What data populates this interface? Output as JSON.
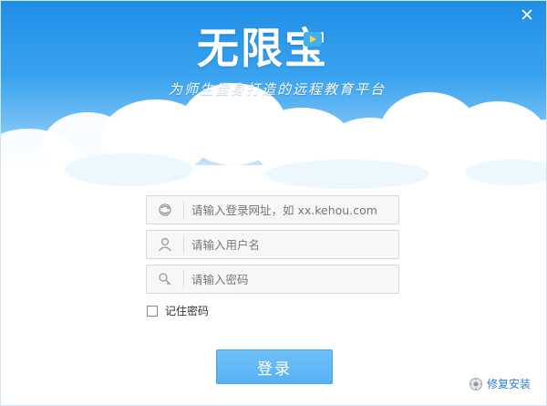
{
  "app": {
    "logo_text": "无限宝",
    "slogan": "为师生量身打造的远程教育平台"
  },
  "form": {
    "url": {
      "placeholder": "请输入登录网址，如 xx.kehou.com",
      "value": "",
      "icon": "refresh-globe-icon"
    },
    "username": {
      "placeholder": "请输入用户名",
      "value": "",
      "icon": "user-icon"
    },
    "password": {
      "placeholder": "请输入密码",
      "value": "",
      "icon": "key-icon"
    },
    "remember_label": "记住密码",
    "remember_checked": false,
    "login_label": "登录"
  },
  "footer": {
    "repair_label": "修复安装",
    "repair_icon": "repair-icon"
  },
  "colors": {
    "sky_top": "#1f8ee6",
    "button": "#56b2f3",
    "link": "#2b7fd1"
  }
}
